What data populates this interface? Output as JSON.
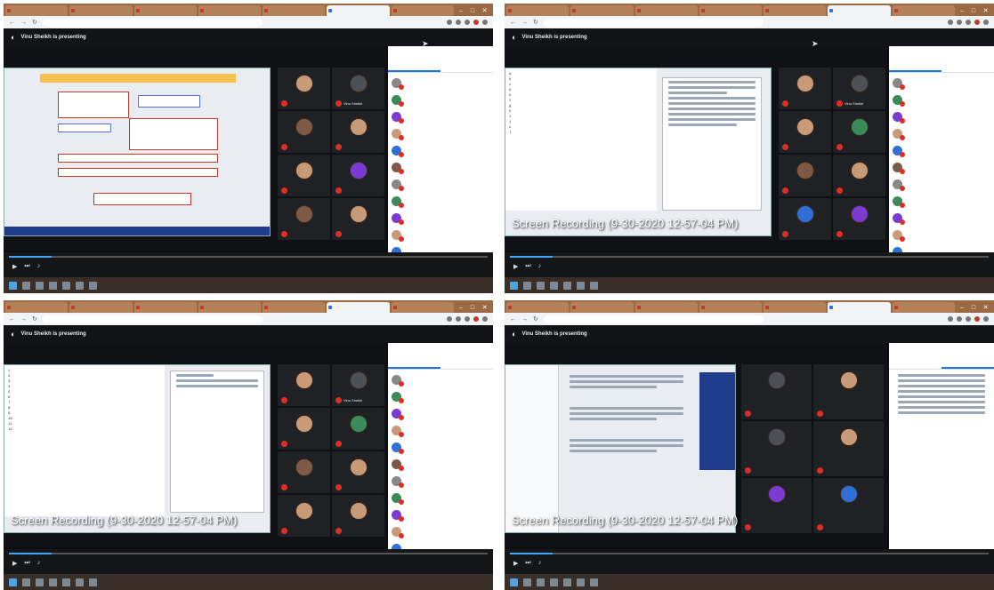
{
  "panels": [
    {
      "tabs": [
        "",
        "",
        "",
        "",
        "",
        "",
        ""
      ],
      "presenting": "Vinu Sheikh is presenting",
      "recording": "",
      "tiles": [
        {
          "name": "",
          "face": "f"
        },
        {
          "name": "Vinu Sheikh",
          "face": "d"
        },
        {
          "name": "",
          "face": "m"
        },
        {
          "name": "",
          "face": "f"
        },
        {
          "name": "",
          "face": "f"
        },
        {
          "name": "",
          "face": "p"
        },
        {
          "name": "",
          "face": "m"
        },
        {
          "name": "",
          "face": "f"
        }
      ],
      "side_title": "",
      "people": [
        "",
        "",
        "",
        "",
        "",
        "",
        "",
        "",
        "",
        "",
        ""
      ]
    },
    {
      "tabs": [
        "",
        "",
        "",
        "",
        "",
        "",
        ""
      ],
      "presenting": "Vinu Sheikh is presenting",
      "recording": "Screen Recording (9-30-2020 12-57-04 PM)",
      "tiles": [
        {
          "name": "",
          "face": "f"
        },
        {
          "name": "Vinu Sheikh",
          "face": "d"
        },
        {
          "name": "",
          "face": "f"
        },
        {
          "name": "",
          "face": "g"
        },
        {
          "name": "",
          "face": "m"
        },
        {
          "name": "",
          "face": "f"
        },
        {
          "name": "",
          "face": "b"
        },
        {
          "name": "",
          "face": "p"
        }
      ],
      "side_title": "",
      "people": [
        "",
        "",
        "",
        "",
        "",
        "",
        "",
        "",
        "",
        "",
        ""
      ]
    },
    {
      "tabs": [
        "",
        "",
        "",
        "",
        "",
        "",
        ""
      ],
      "presenting": "Vinu Sheikh is presenting",
      "recording": "Screen Recording (9-30-2020 12-57-04 PM)",
      "tiles": [
        {
          "name": "",
          "face": "f"
        },
        {
          "name": "Vinu Sheikh",
          "face": "d"
        },
        {
          "name": "",
          "face": "f"
        },
        {
          "name": "",
          "face": "g"
        },
        {
          "name": "",
          "face": "m"
        },
        {
          "name": "",
          "face": "f"
        },
        {
          "name": "",
          "face": "r"
        },
        {
          "name": "",
          "face": "f"
        }
      ],
      "side_title": "",
      "people": [
        "",
        "",
        "",
        "",
        "",
        "",
        "",
        "",
        "",
        "",
        ""
      ]
    },
    {
      "tabs": [
        "",
        "",
        "",
        "",
        "",
        "",
        ""
      ],
      "presenting": "Vinu Sheikh is presenting",
      "recording": "Screen Recording (9-30-2020 12-57-04 PM)",
      "tiles": [
        {
          "name": "",
          "face": "d"
        },
        {
          "name": "",
          "face": "f"
        },
        {
          "name": "",
          "face": "d"
        },
        {
          "name": "",
          "face": "f"
        },
        {
          "name": "",
          "face": "p"
        },
        {
          "name": "",
          "face": "b"
        }
      ],
      "side_title": "",
      "people": []
    }
  ],
  "colors": {
    "meet_dark": "#0b0d10",
    "tab_strip": "#9b6a45",
    "mic_off": "#d93025",
    "accent_blue": "#1a73e8",
    "taskbar": "#3a2f28"
  }
}
